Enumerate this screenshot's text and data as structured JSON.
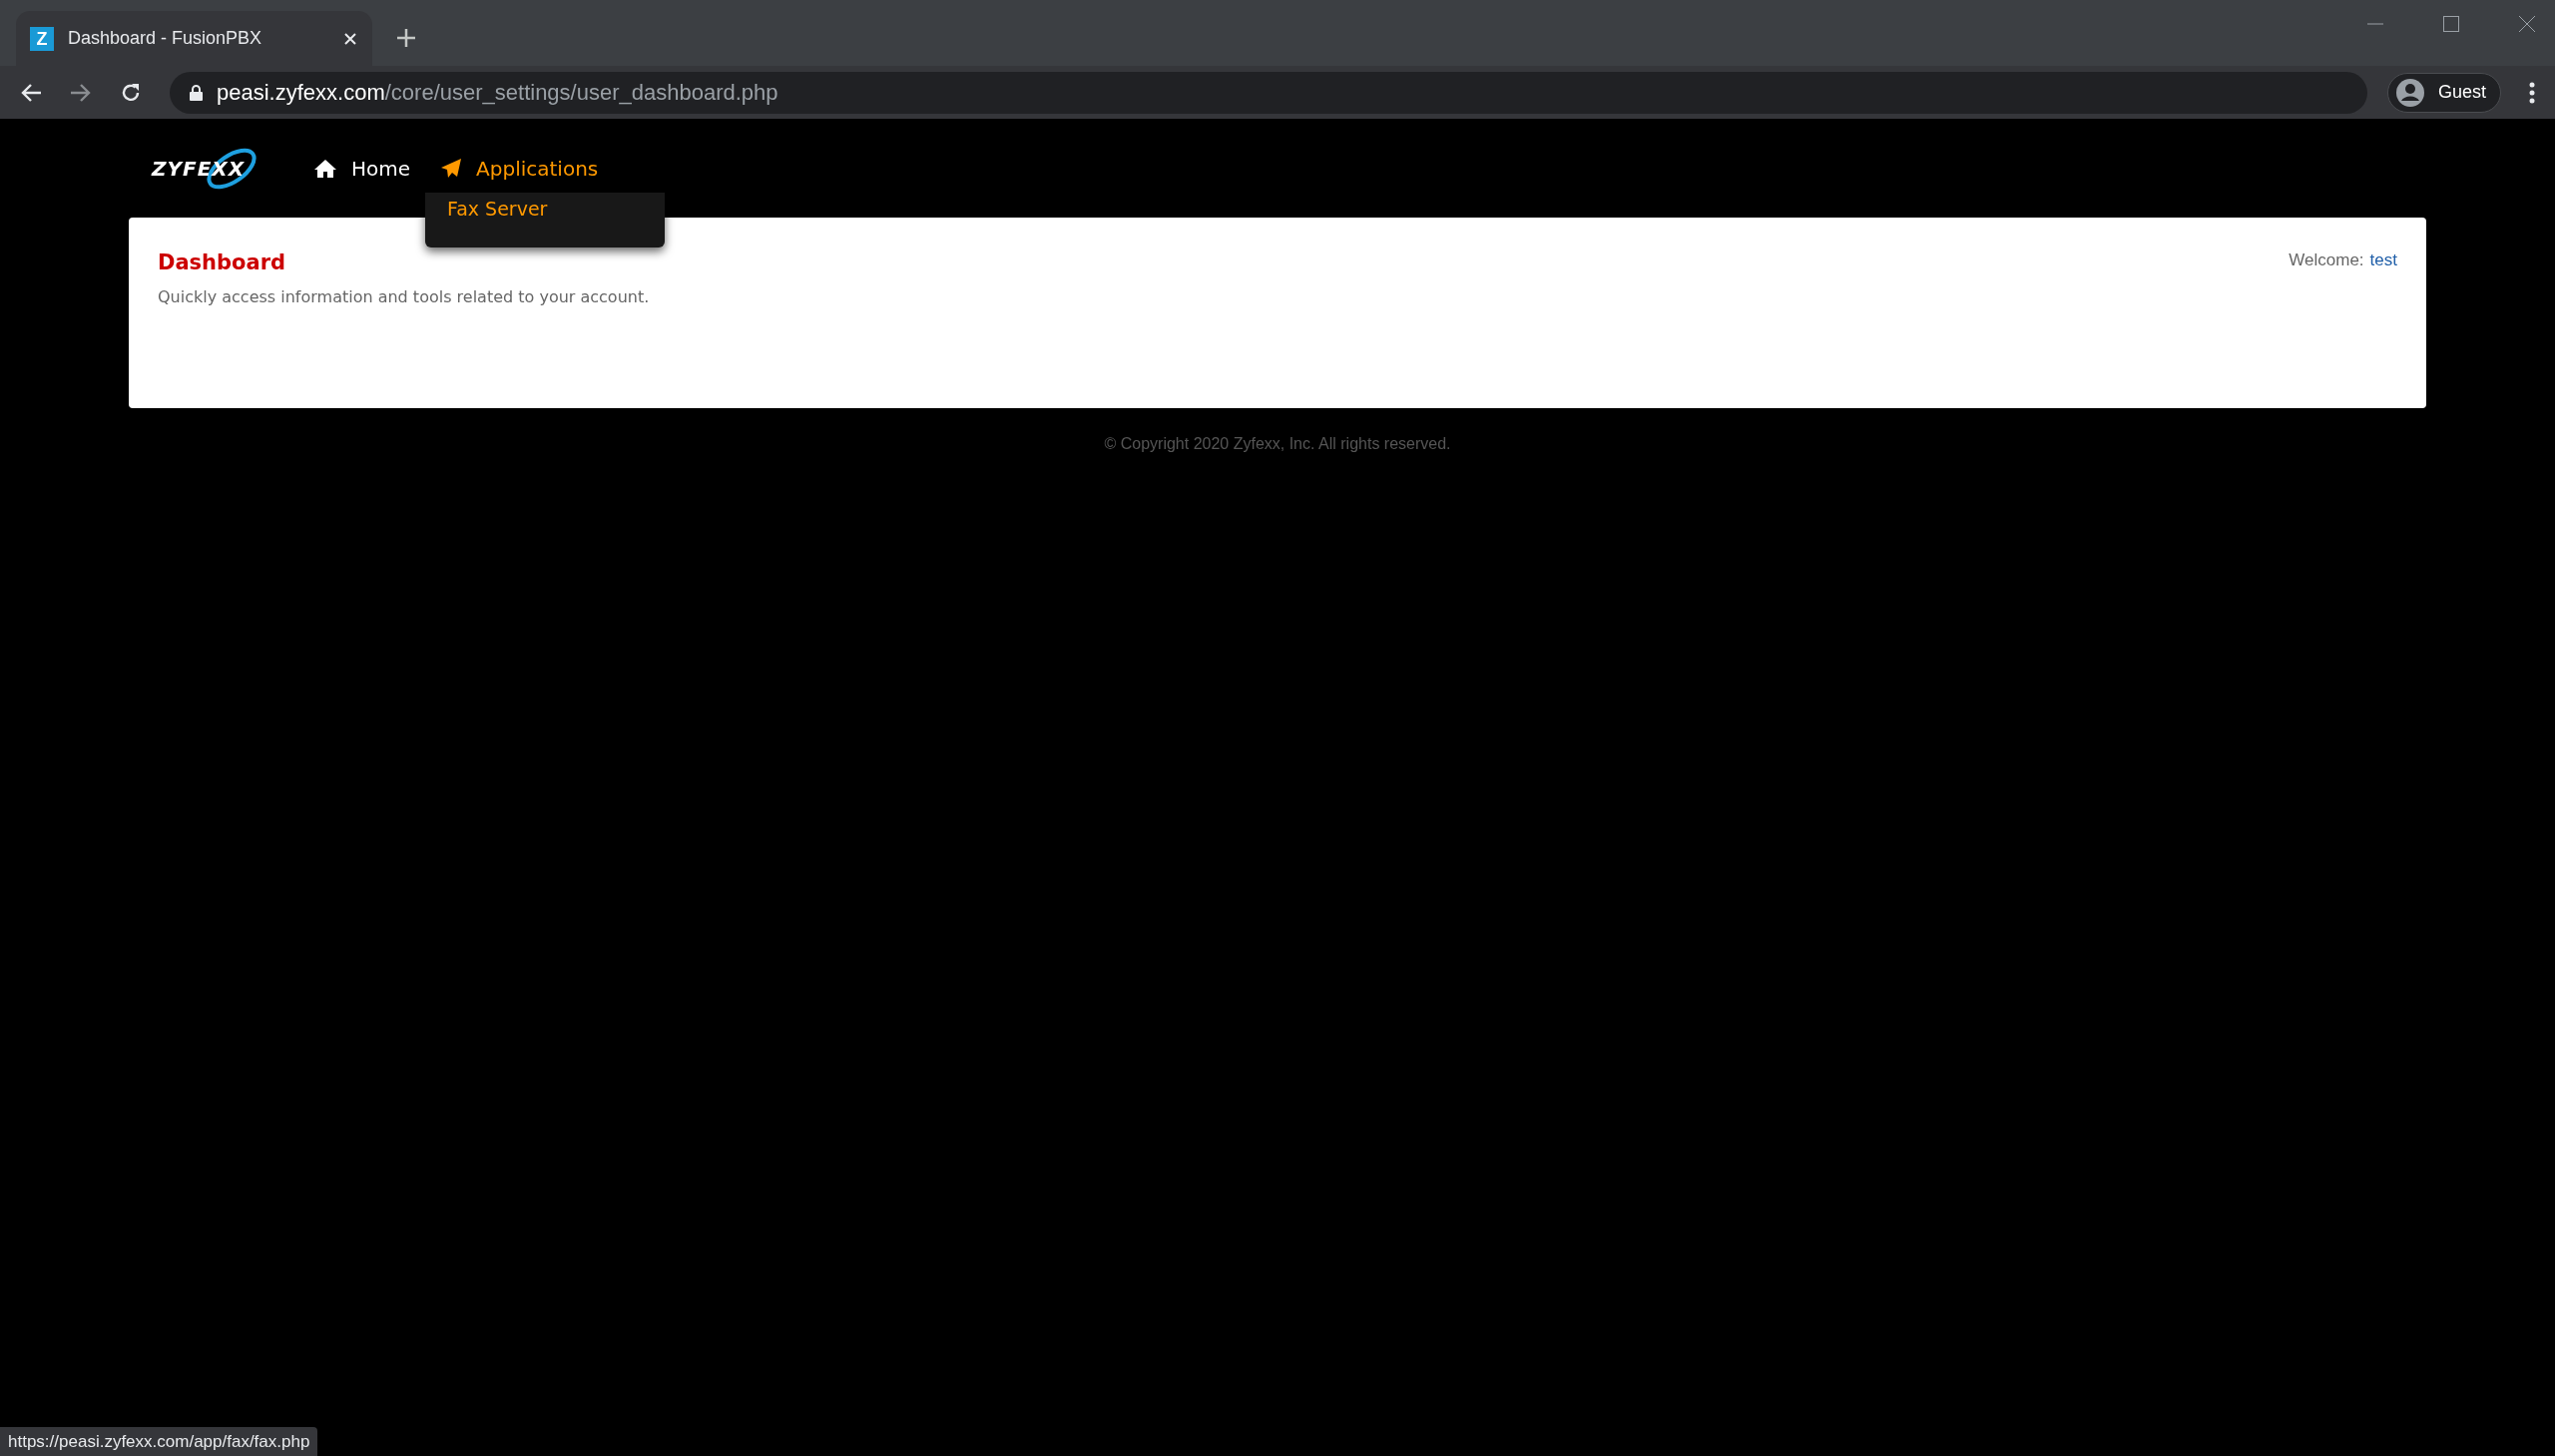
{
  "browser": {
    "tab": {
      "favicon": "Z",
      "title": "Dashboard - FusionPBX"
    },
    "address": {
      "host": "peasi.zyfexx.com",
      "path": "/core/user_settings/user_dashboard.php"
    },
    "profile": "Guest"
  },
  "nav": {
    "logo": "ZYFEXX",
    "items": [
      {
        "label": "Home",
        "kind": "home",
        "selected": false
      },
      {
        "label": "Applications",
        "kind": "apps",
        "selected": true
      }
    ],
    "dropdown": [
      "Fax Server"
    ]
  },
  "card": {
    "title": "Dashboard",
    "description": "Quickly access information and tools related to your account.",
    "welcome_label": "Welcome:",
    "welcome_user": "test"
  },
  "footer": "© Copyright 2020 Zyfexx, Inc. All rights reserved.",
  "status_url": "https://peasi.zyfexx.com/app/fax/fax.php"
}
